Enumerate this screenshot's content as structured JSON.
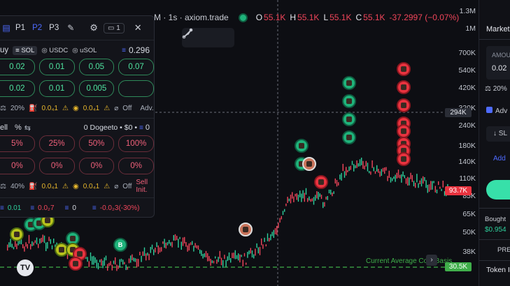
{
  "header": {
    "symbol_fragment": "M · 1s · axiom.trade",
    "ohlc": {
      "o_label": "O",
      "o": "55.1K",
      "h_label": "H",
      "h": "55.1K",
      "l_label": "L",
      "l": "55.1K",
      "c_label": "C",
      "c": "55.1K",
      "change": "-37.2997 (−0.07%)"
    }
  },
  "panel": {
    "presets": [
      "P1",
      "P2",
      "P3"
    ],
    "count": "1",
    "buy": {
      "label": "uy",
      "token_tabs": [
        "SOL",
        "USDC",
        "uSOL"
      ],
      "balance": "0.296",
      "amounts_row1": [
        "0.02",
        "0.01",
        "0.05",
        "0.07"
      ],
      "amounts_row2": [
        "0.02",
        "0.01",
        "0.005",
        ""
      ],
      "settings": {
        "slippage": "20%",
        "priority": "0.0₄1",
        "bribe": "0.0₄1",
        "mev": "Off",
        "adv": "Adv."
      }
    },
    "sell": {
      "label": "ell",
      "percent_label": "%",
      "holding": "0 Dogeeto • $0 •",
      "holding_count": "0",
      "row1": [
        "5%",
        "25%",
        "50%",
        "100%"
      ],
      "row2": [
        "0%",
        "0%",
        "0%",
        "0%"
      ],
      "settings": {
        "slippage": "40%",
        "priority": "0.0₄1",
        "bribe": "0.0₄1",
        "mev": "Off",
        "init": "Sell Init."
      }
    },
    "footer": {
      "a": "0.01",
      "b": "0.0₂7",
      "c": "0",
      "d": "-0.0₂3(-30%)"
    }
  },
  "axis": {
    "ticks": [
      "1.3M",
      "1M",
      "700K",
      "540K",
      "420K",
      "320K",
      "240K",
      "180K",
      "140K",
      "110K",
      "85K",
      "65K",
      "50K",
      "38K"
    ],
    "crosshair_price": "294K",
    "last_price": "93.7K",
    "avg_cost_price": "30.5K",
    "avg_cost_label": "Current Average Cost Basis"
  },
  "right_panel": {
    "market_tab": "Market",
    "amount_label": "AMOU",
    "amount_value": "0.02",
    "slippage": "20%",
    "adv_label": "Adv",
    "sl_label": "SL",
    "add_label": "Add",
    "bought_label": "Bought",
    "bought_value": "$0.954",
    "preset_label": "PRES",
    "token_info_label": "Token In"
  },
  "badges": {
    "b_marker": "B"
  },
  "colors": {
    "up": "#2ecf9c",
    "down": "#f0455a",
    "accent": "#4e6bff"
  }
}
